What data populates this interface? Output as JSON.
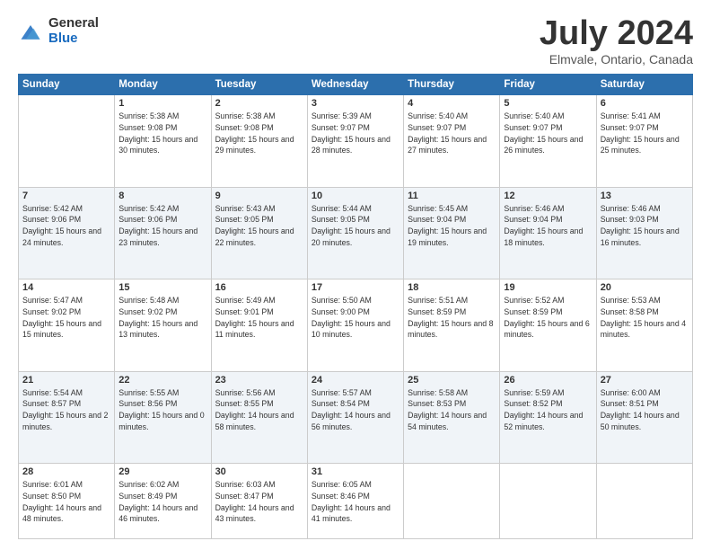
{
  "logo": {
    "general": "General",
    "blue": "Blue"
  },
  "title": {
    "month_year": "July 2024",
    "location": "Elmvale, Ontario, Canada"
  },
  "days_of_week": [
    "Sunday",
    "Monday",
    "Tuesday",
    "Wednesday",
    "Thursday",
    "Friday",
    "Saturday"
  ],
  "weeks": [
    [
      {
        "num": "",
        "sunrise": "",
        "sunset": "",
        "daylight": ""
      },
      {
        "num": "1",
        "sunrise": "Sunrise: 5:38 AM",
        "sunset": "Sunset: 9:08 PM",
        "daylight": "Daylight: 15 hours and 30 minutes."
      },
      {
        "num": "2",
        "sunrise": "Sunrise: 5:38 AM",
        "sunset": "Sunset: 9:08 PM",
        "daylight": "Daylight: 15 hours and 29 minutes."
      },
      {
        "num": "3",
        "sunrise": "Sunrise: 5:39 AM",
        "sunset": "Sunset: 9:07 PM",
        "daylight": "Daylight: 15 hours and 28 minutes."
      },
      {
        "num": "4",
        "sunrise": "Sunrise: 5:40 AM",
        "sunset": "Sunset: 9:07 PM",
        "daylight": "Daylight: 15 hours and 27 minutes."
      },
      {
        "num": "5",
        "sunrise": "Sunrise: 5:40 AM",
        "sunset": "Sunset: 9:07 PM",
        "daylight": "Daylight: 15 hours and 26 minutes."
      },
      {
        "num": "6",
        "sunrise": "Sunrise: 5:41 AM",
        "sunset": "Sunset: 9:07 PM",
        "daylight": "Daylight: 15 hours and 25 minutes."
      }
    ],
    [
      {
        "num": "7",
        "sunrise": "Sunrise: 5:42 AM",
        "sunset": "Sunset: 9:06 PM",
        "daylight": "Daylight: 15 hours and 24 minutes."
      },
      {
        "num": "8",
        "sunrise": "Sunrise: 5:42 AM",
        "sunset": "Sunset: 9:06 PM",
        "daylight": "Daylight: 15 hours and 23 minutes."
      },
      {
        "num": "9",
        "sunrise": "Sunrise: 5:43 AM",
        "sunset": "Sunset: 9:05 PM",
        "daylight": "Daylight: 15 hours and 22 minutes."
      },
      {
        "num": "10",
        "sunrise": "Sunrise: 5:44 AM",
        "sunset": "Sunset: 9:05 PM",
        "daylight": "Daylight: 15 hours and 20 minutes."
      },
      {
        "num": "11",
        "sunrise": "Sunrise: 5:45 AM",
        "sunset": "Sunset: 9:04 PM",
        "daylight": "Daylight: 15 hours and 19 minutes."
      },
      {
        "num": "12",
        "sunrise": "Sunrise: 5:46 AM",
        "sunset": "Sunset: 9:04 PM",
        "daylight": "Daylight: 15 hours and 18 minutes."
      },
      {
        "num": "13",
        "sunrise": "Sunrise: 5:46 AM",
        "sunset": "Sunset: 9:03 PM",
        "daylight": "Daylight: 15 hours and 16 minutes."
      }
    ],
    [
      {
        "num": "14",
        "sunrise": "Sunrise: 5:47 AM",
        "sunset": "Sunset: 9:02 PM",
        "daylight": "Daylight: 15 hours and 15 minutes."
      },
      {
        "num": "15",
        "sunrise": "Sunrise: 5:48 AM",
        "sunset": "Sunset: 9:02 PM",
        "daylight": "Daylight: 15 hours and 13 minutes."
      },
      {
        "num": "16",
        "sunrise": "Sunrise: 5:49 AM",
        "sunset": "Sunset: 9:01 PM",
        "daylight": "Daylight: 15 hours and 11 minutes."
      },
      {
        "num": "17",
        "sunrise": "Sunrise: 5:50 AM",
        "sunset": "Sunset: 9:00 PM",
        "daylight": "Daylight: 15 hours and 10 minutes."
      },
      {
        "num": "18",
        "sunrise": "Sunrise: 5:51 AM",
        "sunset": "Sunset: 8:59 PM",
        "daylight": "Daylight: 15 hours and 8 minutes."
      },
      {
        "num": "19",
        "sunrise": "Sunrise: 5:52 AM",
        "sunset": "Sunset: 8:59 PM",
        "daylight": "Daylight: 15 hours and 6 minutes."
      },
      {
        "num": "20",
        "sunrise": "Sunrise: 5:53 AM",
        "sunset": "Sunset: 8:58 PM",
        "daylight": "Daylight: 15 hours and 4 minutes."
      }
    ],
    [
      {
        "num": "21",
        "sunrise": "Sunrise: 5:54 AM",
        "sunset": "Sunset: 8:57 PM",
        "daylight": "Daylight: 15 hours and 2 minutes."
      },
      {
        "num": "22",
        "sunrise": "Sunrise: 5:55 AM",
        "sunset": "Sunset: 8:56 PM",
        "daylight": "Daylight: 15 hours and 0 minutes."
      },
      {
        "num": "23",
        "sunrise": "Sunrise: 5:56 AM",
        "sunset": "Sunset: 8:55 PM",
        "daylight": "Daylight: 14 hours and 58 minutes."
      },
      {
        "num": "24",
        "sunrise": "Sunrise: 5:57 AM",
        "sunset": "Sunset: 8:54 PM",
        "daylight": "Daylight: 14 hours and 56 minutes."
      },
      {
        "num": "25",
        "sunrise": "Sunrise: 5:58 AM",
        "sunset": "Sunset: 8:53 PM",
        "daylight": "Daylight: 14 hours and 54 minutes."
      },
      {
        "num": "26",
        "sunrise": "Sunrise: 5:59 AM",
        "sunset": "Sunset: 8:52 PM",
        "daylight": "Daylight: 14 hours and 52 minutes."
      },
      {
        "num": "27",
        "sunrise": "Sunrise: 6:00 AM",
        "sunset": "Sunset: 8:51 PM",
        "daylight": "Daylight: 14 hours and 50 minutes."
      }
    ],
    [
      {
        "num": "28",
        "sunrise": "Sunrise: 6:01 AM",
        "sunset": "Sunset: 8:50 PM",
        "daylight": "Daylight: 14 hours and 48 minutes."
      },
      {
        "num": "29",
        "sunrise": "Sunrise: 6:02 AM",
        "sunset": "Sunset: 8:49 PM",
        "daylight": "Daylight: 14 hours and 46 minutes."
      },
      {
        "num": "30",
        "sunrise": "Sunrise: 6:03 AM",
        "sunset": "Sunset: 8:47 PM",
        "daylight": "Daylight: 14 hours and 43 minutes."
      },
      {
        "num": "31",
        "sunrise": "Sunrise: 6:05 AM",
        "sunset": "Sunset: 8:46 PM",
        "daylight": "Daylight: 14 hours and 41 minutes."
      },
      {
        "num": "",
        "sunrise": "",
        "sunset": "",
        "daylight": ""
      },
      {
        "num": "",
        "sunrise": "",
        "sunset": "",
        "daylight": ""
      },
      {
        "num": "",
        "sunrise": "",
        "sunset": "",
        "daylight": ""
      }
    ]
  ]
}
